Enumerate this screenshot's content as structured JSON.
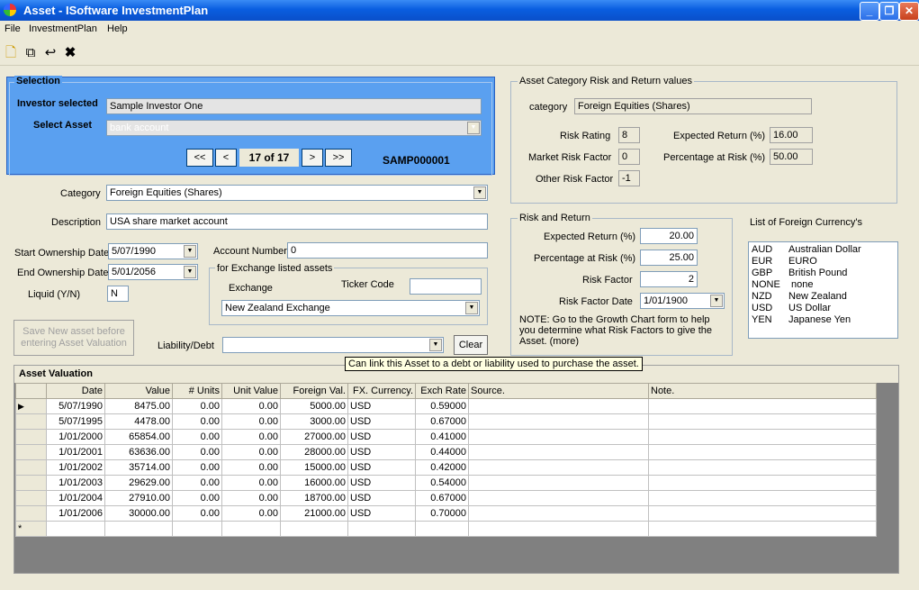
{
  "window": {
    "title": "Asset - ISoftware InvestmentPlan"
  },
  "menu": [
    "File",
    "InvestmentPlan",
    "Help"
  ],
  "selection": {
    "title": "Selection",
    "investor_label": "Investor selected",
    "investor_value": "Sample Investor One",
    "asset_label": "Select Asset",
    "asset_value": "bank account",
    "nav_first": "<<",
    "nav_prev": "<",
    "record": "17 of  17",
    "nav_next": ">",
    "nav_last": ">>",
    "code": "SAMP000001"
  },
  "category": {
    "label": "Category",
    "value": "Foreign Equities (Shares)"
  },
  "description": {
    "label": "Description",
    "value": "USA share market account"
  },
  "start_date": {
    "label": "Start Ownership Date",
    "value": "5/07/1990"
  },
  "end_date": {
    "label": "End Ownership Date",
    "value": "5/01/2056"
  },
  "liquid": {
    "label": "Liquid (Y/N)",
    "value": "N"
  },
  "account_number": {
    "label": "Account Number",
    "value": "0"
  },
  "exchange_group": {
    "title": "for Exchange listed assets",
    "exchange_label": "Exchange",
    "ticker_label": "Ticker Code",
    "exchange_value": "New Zealand Exchange",
    "ticker_value": ""
  },
  "save_button": "Save New asset before entering Asset Valuation",
  "liability": {
    "label": "Liability/Debt",
    "value": "",
    "clear": "Clear"
  },
  "tooltip": "Can link this Asset to a debt or liability used to purchase the asset.",
  "category_risk": {
    "title": "Asset Category Risk and Return values",
    "category_label": "category",
    "category_value": "Foreign Equities (Shares)",
    "risk_rating_label": "Risk Rating",
    "risk_rating": "8",
    "market_risk_label": "Market Risk Factor",
    "market_risk": "0",
    "other_risk_label": "Other Risk Factor",
    "other_risk": "-1",
    "exp_return_label": "Expected Return (%)",
    "exp_return": "16.00",
    "pct_risk_label": "Percentage at Risk (%)",
    "pct_risk": "50.00"
  },
  "risk_return": {
    "title": "Risk and Return",
    "exp_return_label": "Expected Return (%)",
    "exp_return": "20.00",
    "pct_risk_label": "Percentage at Risk (%)",
    "pct_risk": "25.00",
    "risk_factor_label": "Risk Factor",
    "risk_factor": "2",
    "risk_date_label": "Risk Factor Date",
    "risk_date": "1/01/1900",
    "note": "NOTE: Go to the Growth Chart form to help you determine what Risk Factors to give the Asset. (more)"
  },
  "currencies": {
    "title": "List of Foreign Currency's",
    "items": [
      {
        "code": "AUD",
        "name": "Australian Dollar"
      },
      {
        "code": "EUR",
        "name": "EURO"
      },
      {
        "code": "GBP",
        "name": "British Pound"
      },
      {
        "code": "NONE",
        "name": " none"
      },
      {
        "code": "NZD",
        "name": "New Zealand"
      },
      {
        "code": "USD",
        "name": "US Dollar"
      },
      {
        "code": "YEN",
        "name": "Japanese Yen"
      }
    ]
  },
  "valuation": {
    "title": "Asset Valuation",
    "columns": [
      "Date",
      "Value",
      "# Units",
      "Unit Value",
      "Foreign Val.",
      "FX. Currency.",
      "Exch Rate",
      "Source.",
      "Note."
    ],
    "rows": [
      [
        "5/07/1990",
        "8475.00",
        "0.00",
        "0.00",
        "5000.00",
        "USD",
        "0.59000",
        "",
        ""
      ],
      [
        "5/07/1995",
        "4478.00",
        "0.00",
        "0.00",
        "3000.00",
        "USD",
        "0.67000",
        "",
        ""
      ],
      [
        "1/01/2000",
        "65854.00",
        "0.00",
        "0.00",
        "27000.00",
        "USD",
        "0.41000",
        "",
        ""
      ],
      [
        "1/01/2001",
        "63636.00",
        "0.00",
        "0.00",
        "28000.00",
        "USD",
        "0.44000",
        "",
        ""
      ],
      [
        "1/01/2002",
        "35714.00",
        "0.00",
        "0.00",
        "15000.00",
        "USD",
        "0.42000",
        "",
        ""
      ],
      [
        "1/01/2003",
        "29629.00",
        "0.00",
        "0.00",
        "16000.00",
        "USD",
        "0.54000",
        "",
        ""
      ],
      [
        "1/01/2004",
        "27910.00",
        "0.00",
        "0.00",
        "18700.00",
        "USD",
        "0.67000",
        "",
        ""
      ],
      [
        "1/01/2006",
        "30000.00",
        "0.00",
        "0.00",
        "21000.00",
        "USD",
        "0.70000",
        "",
        ""
      ]
    ],
    "current_marker": "▶",
    "new_marker": "*"
  }
}
